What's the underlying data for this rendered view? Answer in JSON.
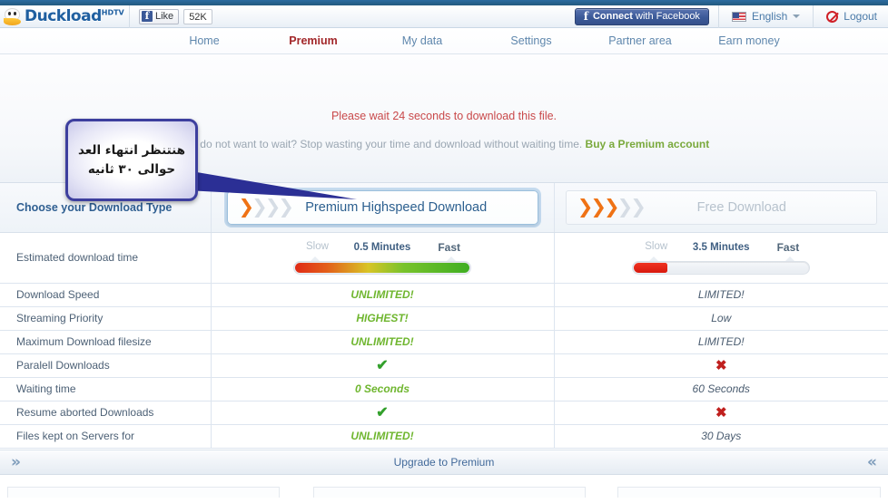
{
  "header": {
    "logo_text": "Duckload",
    "logo_sup": "HDTV",
    "fb_like_label": "Like",
    "fb_like_count": "52K",
    "fb_connect_bold": "Connect",
    "fb_connect_rest": " with Facebook",
    "language": "English",
    "logout": "Logout"
  },
  "nav": {
    "items": [
      {
        "label": "Home",
        "active": false
      },
      {
        "label": "Premium",
        "active": true
      },
      {
        "label": "My data",
        "active": false
      },
      {
        "label": "Settings",
        "active": false
      },
      {
        "label": "Partner area",
        "active": false
      },
      {
        "label": "Earn money",
        "active": false
      }
    ]
  },
  "callout": {
    "line1": "هنتنظر انتهاء العد",
    "line2": "حوالى ٣٠ ثانيه"
  },
  "wait": {
    "message": "Please wait 24 seconds to download this file.",
    "promo_text": "You do not want to wait? Stop wasting your time and download without waiting time. ",
    "promo_link": "Buy a Premium account"
  },
  "table": {
    "choose_label": "Choose your Download Type",
    "premium_button": "Premium Highspeed Download",
    "free_button": "Free Download",
    "gauges": {
      "slow_label": "Slow",
      "fast_label": "Fast",
      "premium_time": "0.5 Minutes",
      "free_time": "3.5 Minutes"
    },
    "rows": [
      {
        "label": "Estimated download time",
        "premium": "",
        "free": "",
        "type": "gauge"
      },
      {
        "label": "Download Speed",
        "premium": "UNLIMITED!",
        "free": "LIMITED!",
        "type": "text"
      },
      {
        "label": "Streaming Priority",
        "premium": "HIGHEST!",
        "free": "Low",
        "type": "text"
      },
      {
        "label": "Maximum Download filesize",
        "premium": "UNLIMITED!",
        "free": "LIMITED!",
        "type": "text"
      },
      {
        "label": "Paralell Downloads",
        "premium": "✔",
        "free": "✖",
        "type": "mark"
      },
      {
        "label": "Waiting time",
        "premium": "0 Seconds",
        "free": "60 Seconds",
        "type": "text"
      },
      {
        "label": "Resume aborted Downloads",
        "premium": "✔",
        "free": "✖",
        "type": "mark"
      },
      {
        "label": "Files kept on Servers for",
        "premium": "UNLIMITED!",
        "free": "30 Days",
        "type": "text"
      }
    ]
  },
  "footer": {
    "left_arrow": "»",
    "center_label": "Upgrade to Premium",
    "right_arrow": "«"
  },
  "colors": {
    "accent_orange": "#ef7215",
    "brand_blue": "#2c5f8f",
    "premium_green": "#6fb62f",
    "warning_red": "#c9494a",
    "facebook_blue": "#3b5998"
  }
}
